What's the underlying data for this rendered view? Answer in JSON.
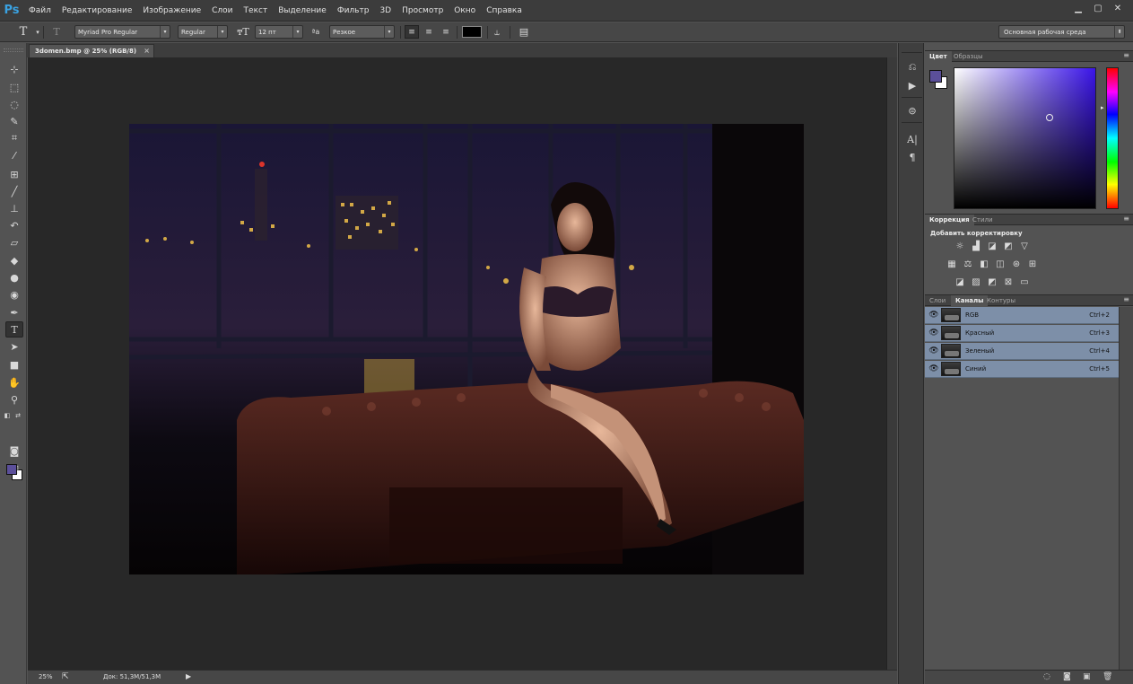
{
  "app": {
    "logo": "Ps"
  },
  "menu": [
    "Файл",
    "Редактирование",
    "Изображение",
    "Слои",
    "Текст",
    "Выделение",
    "Фильтр",
    "3D",
    "Просмотр",
    "Окно",
    "Справка"
  ],
  "window_controls": {
    "minimize": "▁",
    "restore": "▢",
    "close": "✕"
  },
  "options": {
    "font_family": "Myriad Pro Regular",
    "font_style": "Regular",
    "font_size": "12 пт",
    "aa_label": "ªa",
    "antialias": "Резкое",
    "text_color": "#000000",
    "workspace": "Основная рабочая среда"
  },
  "document": {
    "tab_title": "3domen.bmp @ 25% (RGB/8)",
    "close_glyph": "×"
  },
  "status": {
    "zoom": "25%",
    "doc_size": "Док: 51,3M/51,3M",
    "arrow": "▶"
  },
  "colors": {
    "foreground": "#5b4f9a",
    "background": "#ffffff"
  },
  "panels": {
    "color_tabs": [
      "Цвет",
      "Образцы"
    ],
    "adjust_tabs": [
      "Коррекция",
      "Стили"
    ],
    "adjust_title": "Добавить корректировку",
    "layers_tabs": [
      "Слои",
      "Каналы",
      "Контуры"
    ],
    "menu_glyph": "≡"
  },
  "channels": [
    {
      "name": "RGB",
      "shortcut": "Ctrl+2"
    },
    {
      "name": "Красный",
      "shortcut": "Ctrl+3"
    },
    {
      "name": "Зеленый",
      "shortcut": "Ctrl+4"
    },
    {
      "name": "Синий",
      "shortcut": "Ctrl+5"
    }
  ],
  "icons": {
    "tools": [
      "move-icon",
      "marquee-icon",
      "lasso-icon",
      "quick-select-icon",
      "crop-icon",
      "eyedropper-icon",
      "healing-brush-icon",
      "brush-icon",
      "clone-stamp-icon",
      "history-brush-icon",
      "eraser-icon",
      "paint-bucket-icon",
      "blur-icon",
      "dodge-icon",
      "pen-icon",
      "type-icon",
      "path-select-icon",
      "rectangle-icon",
      "hand-icon",
      "zoom-icon"
    ],
    "strip": [
      "history-icon",
      "actions-icon",
      "tool-presets-icon",
      "character-icon",
      "paragraph-icon"
    ]
  }
}
